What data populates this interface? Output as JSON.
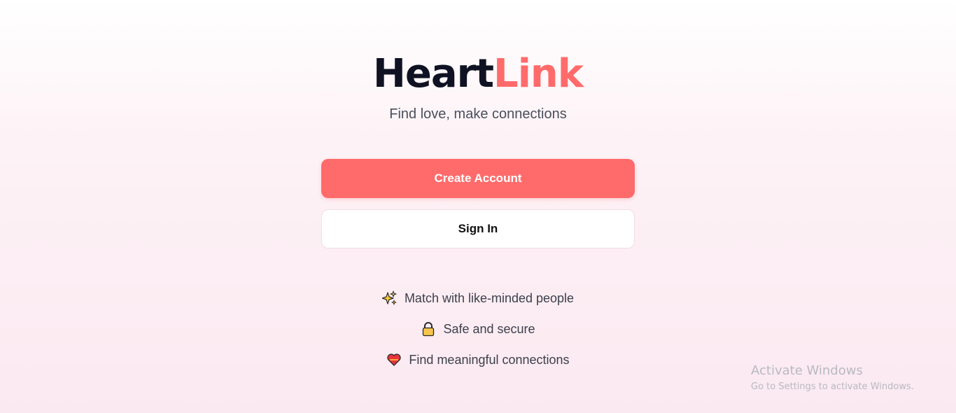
{
  "brand": {
    "name_part1": "Heart",
    "name_part2": "Link",
    "tagline": "Find love, make connections",
    "accent_color": "#ff6b6b",
    "text_color": "#0f1222"
  },
  "actions": {
    "create_account_label": "Create Account",
    "sign_in_label": "Sign In"
  },
  "features": [
    {
      "icon": "sparkles-icon",
      "text": "Match with like-minded people"
    },
    {
      "icon": "lock-icon",
      "text": "Safe and secure"
    },
    {
      "icon": "heart-icon",
      "text": "Find meaningful connections"
    }
  ],
  "watermark": {
    "title": "Activate Windows",
    "subtitle": "Go to Settings to activate Windows."
  }
}
